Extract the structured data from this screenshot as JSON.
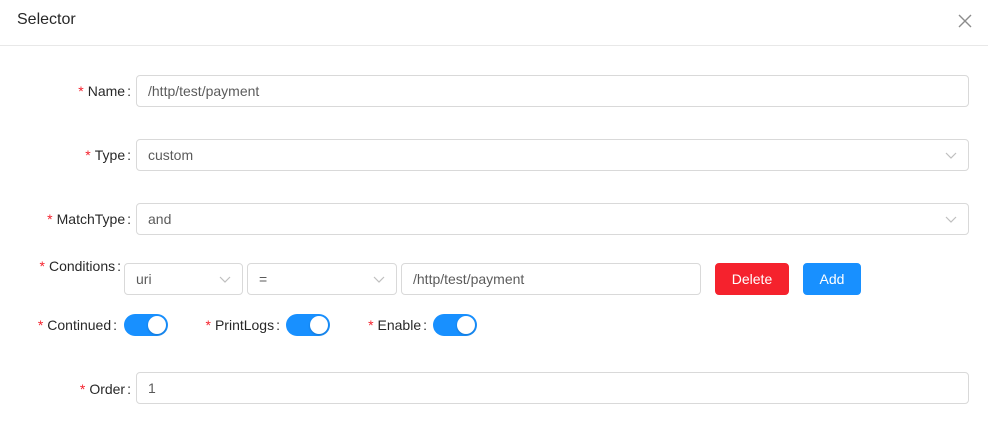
{
  "dialog": {
    "title": "Selector",
    "close_icon": "close-icon"
  },
  "form": {
    "name": {
      "label": "Name",
      "value": "/http/test/payment"
    },
    "type": {
      "label": "Type",
      "value": "custom"
    },
    "match_type": {
      "label": "MatchType",
      "value": "and"
    },
    "conditions": {
      "label": "Conditions",
      "param_type": "uri",
      "operator": "=",
      "value": "/http/test/payment",
      "delete_label": "Delete",
      "add_label": "Add"
    },
    "continued": {
      "label": "Continued",
      "on": true
    },
    "print_logs": {
      "label": "PrintLogs",
      "on": true
    },
    "enable": {
      "label": "Enable",
      "on": true
    },
    "order": {
      "label": "Order",
      "value": "1"
    },
    "colon": ":",
    "required_mark": "*"
  },
  "colors": {
    "primary": "#1890ff",
    "danger": "#f5222d",
    "border": "#d9d9d9"
  }
}
